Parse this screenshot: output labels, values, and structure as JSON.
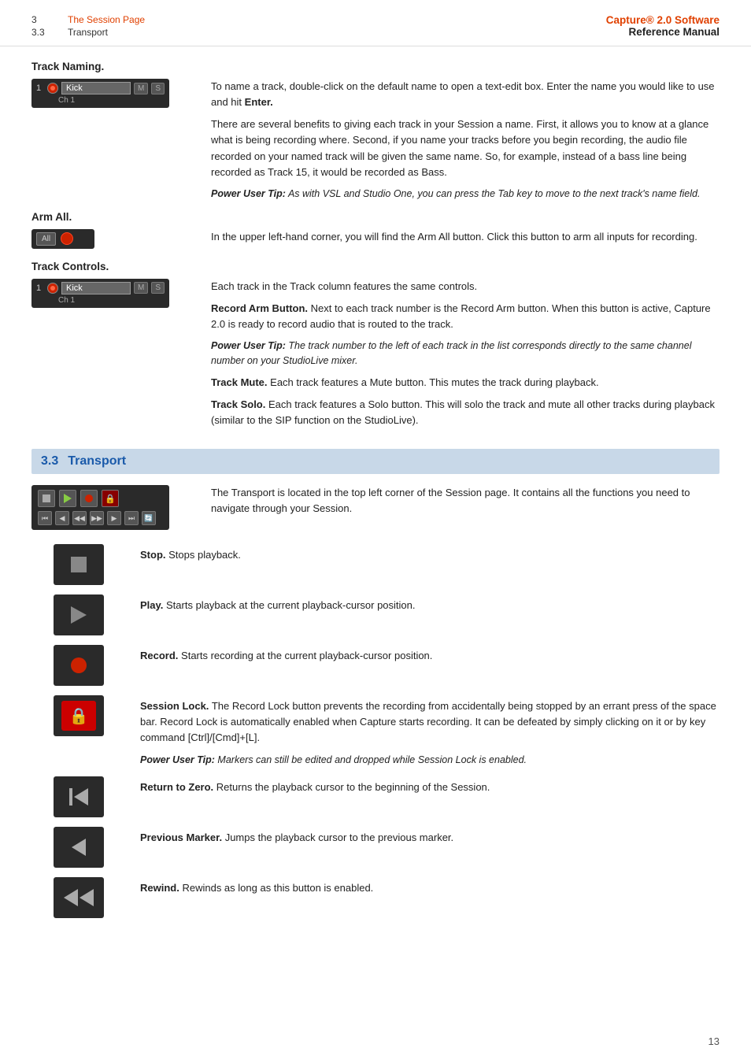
{
  "header": {
    "chapter_num_1": "3",
    "chapter_title_1": "The Session Page",
    "chapter_num_2": "3.3",
    "chapter_title_2": "Transport",
    "brand": "Capture® 2.0 Software",
    "manual_title": "Reference Manual"
  },
  "track_naming": {
    "section_label": "Track Naming.",
    "track_name": "Kick",
    "track_ch": "Ch 1",
    "track_m": "M",
    "track_s": "S",
    "description_1": "To name a track, double-click on the default name to open a text-edit box. Enter the name you would like to use and hit ",
    "description_1_bold": "Enter.",
    "description_2": "There are several benefits to giving each track in your Session a name. First, it allows you to know at a glance what is being recording where. Second, if you name your tracks before you begin recording, the audio file recorded on your named track will be given the same name. So, for example, instead of a bass line being recorded as Track 15, it would be recorded as Bass.",
    "power_tip_bold": "Power User Tip:",
    "power_tip_text": " As with VSL and Studio One, you can press the Tab key to move to the next track's name field."
  },
  "arm_all": {
    "section_label": "Arm All.",
    "btn_label": "All",
    "description": "In the upper left-hand corner, you will find the Arm All button. Click this button to arm all inputs for recording."
  },
  "track_controls": {
    "section_label": "Track Controls.",
    "track_name": "Kick",
    "track_ch": "Ch 1",
    "track_m": "M",
    "track_s": "S",
    "description_1": "Each track in the Track column features the same controls.",
    "record_arm_bold": "Record Arm Button.",
    "record_arm_text": " Next to each track number is the Record Arm button. When this button is active, Capture 2.0 is ready to record audio that is routed to the track.",
    "power_tip_bold": "Power User Tip:",
    "power_tip_text": " The track number to the left of each track in the list corresponds directly to the same channel number on your StudioLive mixer.",
    "track_mute_bold": "Track Mute.",
    "track_mute_text": " Each track features a Mute button. This mutes the track during playback.",
    "track_solo_bold": "Track Solo.",
    "track_solo_text": " Each track features a Solo button. This will solo the track and mute all other tracks during playback (similar to the SIP function on the StudioLive)."
  },
  "section_33": {
    "num": "3.3",
    "title": "Transport",
    "description": "The Transport is located in the top left corner of the Session page. It contains all the functions you need to navigate through your Session."
  },
  "transport_items": [
    {
      "icon_type": "stop",
      "bold": "Stop.",
      "text": " Stops playback."
    },
    {
      "icon_type": "play",
      "bold": "Play.",
      "text": " Starts playback at the current playback-cursor position."
    },
    {
      "icon_type": "record",
      "bold": "Record.",
      "text": " Starts recording at the current playback-cursor position."
    },
    {
      "icon_type": "lock",
      "bold": "Session Lock.",
      "text": " The Record Lock button prevents the recording from accidentally being stopped by an errant press of the space bar. Record Lock is automatically enabled when Capture starts recording. It can be defeated by simply clicking on it or by key command [Ctrl]/[Cmd]+[L].",
      "power_tip_bold": "Power User Tip:",
      "power_tip_text": " Markers can still be edited and dropped while Session Lock is enabled."
    },
    {
      "icon_type": "return_to_zero",
      "bold": "Return to Zero.",
      "text": " Returns the playback cursor to the beginning of the Session."
    },
    {
      "icon_type": "previous_marker",
      "bold": "Previous Marker.",
      "text": " Jumps the playback cursor to the previous marker."
    },
    {
      "icon_type": "rewind",
      "bold": "Rewind.",
      "text": " Rewinds as long as this button is enabled."
    }
  ],
  "page_number": "13"
}
